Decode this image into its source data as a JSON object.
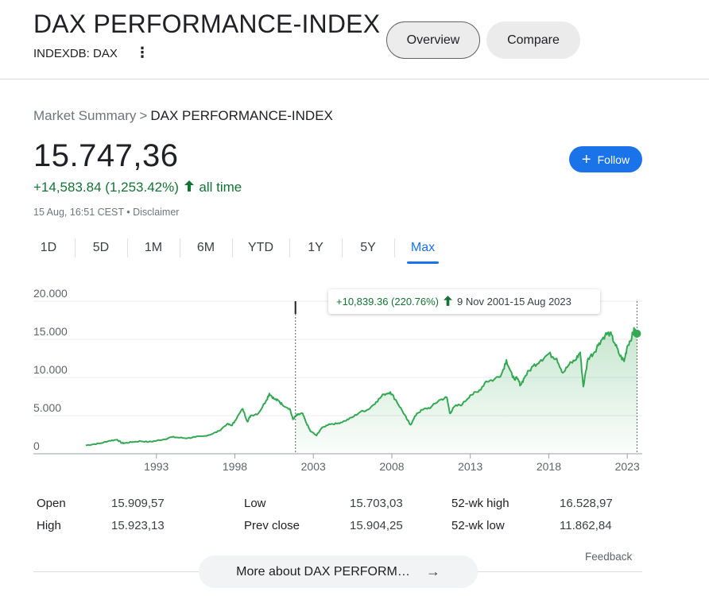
{
  "header": {
    "title": "DAX PERFORMANCE-INDEX",
    "ticker": "INDEXDB: DAX",
    "menu_icon": "more-vert-icon",
    "overview_label": "Overview",
    "compare_label": "Compare"
  },
  "breadcrumb": {
    "root": "Market Summary",
    "separator": ">",
    "current": "DAX PERFORMANCE-INDEX"
  },
  "quote": {
    "price": "15.747,36",
    "change": "+14,583.84 (1,253.42%)",
    "change_arrow": "arrow-up-icon",
    "period": "all time",
    "timestamp": "15 Aug, 16:51 CEST",
    "bullet": "•",
    "disclaimer": "Disclaimer",
    "follow_label": "Follow",
    "follow_icon": "plus-icon"
  },
  "tabs": [
    {
      "label": "1D",
      "active": false
    },
    {
      "label": "5D",
      "active": false
    },
    {
      "label": "1M",
      "active": false
    },
    {
      "label": "6M",
      "active": false
    },
    {
      "label": "YTD",
      "active": false
    },
    {
      "label": "1Y",
      "active": false
    },
    {
      "label": "5Y",
      "active": false
    },
    {
      "label": "Max",
      "active": true
    }
  ],
  "tooltip": {
    "change": "+10,839.36 (220.76%)",
    "arrow": "arrow-up-icon",
    "range": "9 Nov 2001-15 Aug 2023"
  },
  "chart_data": {
    "type": "area",
    "title": "",
    "xlabel": "",
    "ylabel": "",
    "ylim": [
      0,
      20000
    ],
    "xlim": [
      1988.0,
      2023.7
    ],
    "y_ticks": [
      "20.000",
      "15.000",
      "10.000",
      "5.000",
      "0"
    ],
    "y_tick_values": [
      20000,
      15000,
      10000,
      5000,
      0
    ],
    "x_ticks": [
      "1993",
      "1998",
      "2003",
      "2008",
      "2013",
      "2018",
      "2023"
    ],
    "x_tick_values": [
      1993,
      1998,
      2003,
      2008,
      2013,
      2018,
      2023
    ],
    "grid": true,
    "line_color": "#34a853",
    "fill_color": "#34a853",
    "highlight_range": [
      2001.86,
      2023.62
    ],
    "series": [
      {
        "values": [
          [
            1988.5,
            1100
          ],
          [
            1989.0,
            1250
          ],
          [
            1989.5,
            1400
          ],
          [
            1990.0,
            1700
          ],
          [
            1990.5,
            1850
          ],
          [
            1990.8,
            1400
          ],
          [
            1991.0,
            1400
          ],
          [
            1991.5,
            1550
          ],
          [
            1992.0,
            1650
          ],
          [
            1992.5,
            1550
          ],
          [
            1993.0,
            1700
          ],
          [
            1993.5,
            1900
          ],
          [
            1994.0,
            2200
          ],
          [
            1994.5,
            2100
          ],
          [
            1995.0,
            2050
          ],
          [
            1995.5,
            2200
          ],
          [
            1996.0,
            2300
          ],
          [
            1996.5,
            2550
          ],
          [
            1997.0,
            3000
          ],
          [
            1997.5,
            3900
          ],
          [
            1997.8,
            3700
          ],
          [
            1998.0,
            4300
          ],
          [
            1998.5,
            5900
          ],
          [
            1998.8,
            4200
          ],
          [
            1999.0,
            5000
          ],
          [
            1999.5,
            5300
          ],
          [
            2000.0,
            7000
          ],
          [
            2000.2,
            7900
          ],
          [
            2000.5,
            7200
          ],
          [
            2000.8,
            6900
          ],
          [
            2001.0,
            6500
          ],
          [
            2001.5,
            5900
          ],
          [
            2001.7,
            4500
          ],
          [
            2001.86,
            4908
          ],
          [
            2002.0,
            5100
          ],
          [
            2002.3,
            5300
          ],
          [
            2002.5,
            4300
          ],
          [
            2002.8,
            3000
          ],
          [
            2003.2,
            2400
          ],
          [
            2003.5,
            3300
          ],
          [
            2004.0,
            3900
          ],
          [
            2004.5,
            3950
          ],
          [
            2005.0,
            4300
          ],
          [
            2005.5,
            4800
          ],
          [
            2006.0,
            5500
          ],
          [
            2006.5,
            5800
          ],
          [
            2007.0,
            6800
          ],
          [
            2007.5,
            7800
          ],
          [
            2007.9,
            8100
          ],
          [
            2008.3,
            6900
          ],
          [
            2008.7,
            5500
          ],
          [
            2009.0,
            4400
          ],
          [
            2009.2,
            3800
          ],
          [
            2009.6,
            5300
          ],
          [
            2010.0,
            5800
          ],
          [
            2010.5,
            6100
          ],
          [
            2011.0,
            7000
          ],
          [
            2011.5,
            7400
          ],
          [
            2011.7,
            5300
          ],
          [
            2012.0,
            6200
          ],
          [
            2012.5,
            6500
          ],
          [
            2013.0,
            7700
          ],
          [
            2013.5,
            8100
          ],
          [
            2014.0,
            9500
          ],
          [
            2014.5,
            9700
          ],
          [
            2015.0,
            10500
          ],
          [
            2015.3,
            12300
          ],
          [
            2015.7,
            10000
          ],
          [
            2016.0,
            9800
          ],
          [
            2016.2,
            9000
          ],
          [
            2016.5,
            10200
          ],
          [
            2017.0,
            11500
          ],
          [
            2017.5,
            12300
          ],
          [
            2018.0,
            13100
          ],
          [
            2018.5,
            12500
          ],
          [
            2018.9,
            10600
          ],
          [
            2019.3,
            11700
          ],
          [
            2019.7,
            12300
          ],
          [
            2020.0,
            13300
          ],
          [
            2020.2,
            8800
          ],
          [
            2020.5,
            12500
          ],
          [
            2020.9,
            13300
          ],
          [
            2021.2,
            14500
          ],
          [
            2021.6,
            15600
          ],
          [
            2021.9,
            15800
          ],
          [
            2022.2,
            14500
          ],
          [
            2022.5,
            13000
          ],
          [
            2022.8,
            12100
          ],
          [
            2023.0,
            14100
          ],
          [
            2023.3,
            15400
          ],
          [
            2023.45,
            16300
          ],
          [
            2023.62,
            15747
          ]
        ]
      }
    ]
  },
  "stats": [
    {
      "label": "Open",
      "value": "15.909,57"
    },
    {
      "label": "High",
      "value": "15.923,13"
    },
    {
      "label": "Low",
      "value": "15.703,03"
    },
    {
      "label": "Prev close",
      "value": "15.904,25"
    },
    {
      "label": "52-wk high",
      "value": "16.528,97"
    },
    {
      "label": "52-wk low",
      "value": "11.862,84"
    }
  ],
  "footer": {
    "feedback": "Feedback",
    "more_about": "More about DAX PERFORM…",
    "more_arrow": "arrow-right-icon"
  }
}
